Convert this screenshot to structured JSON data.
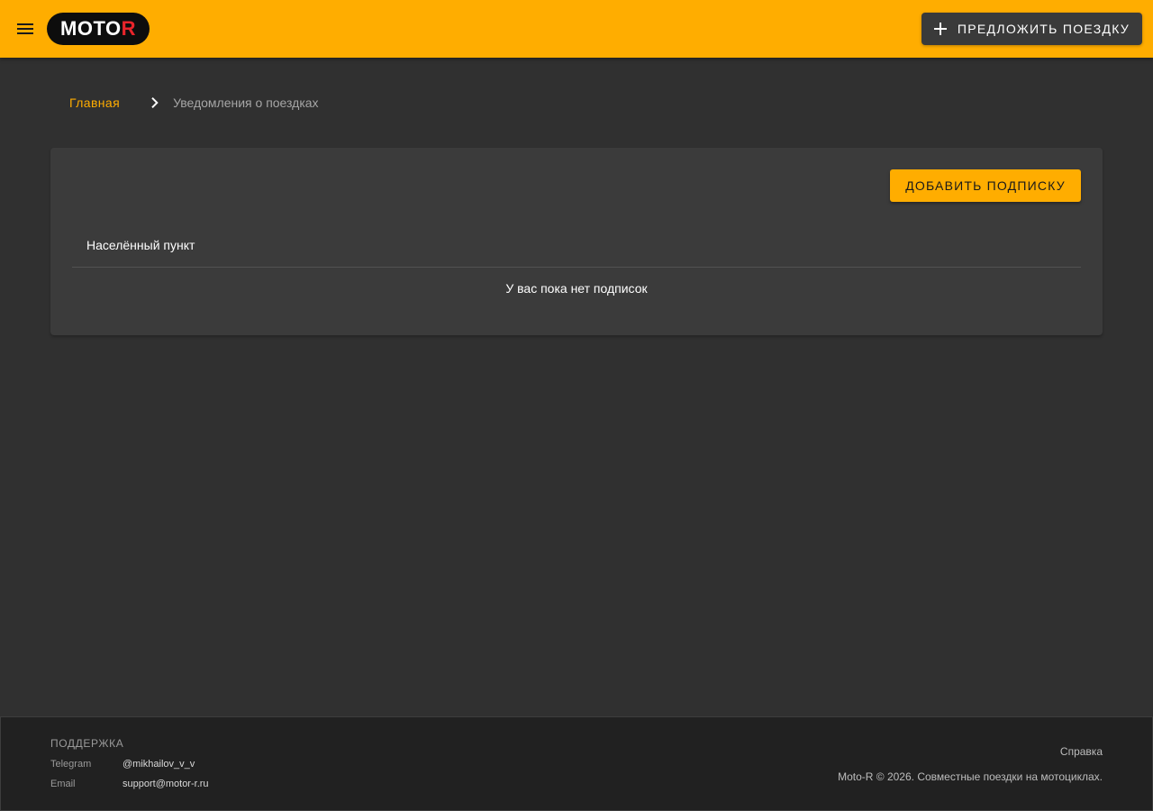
{
  "header": {
    "logo_text_main": "MOTO",
    "logo_text_accent": "R",
    "suggest_button_label": "ПРЕДЛОЖИТЬ ПОЕЗДКУ",
    "icons": {
      "menu": "menu-icon",
      "plus": "plus-icon"
    }
  },
  "breadcrumb": {
    "home": "Главная",
    "current": "Уведомления о поездках",
    "separator_icon": "chevron-right-icon"
  },
  "subscriptions": {
    "add_button_label": "ДОБАВИТЬ ПОДПИСКУ",
    "column_header": "Населённый пункт",
    "empty_message": "У вас пока нет подписок"
  },
  "footer": {
    "support_title": "ПОДДЕРЖКА",
    "contacts": [
      {
        "label": "Telegram",
        "value": "@mikhailov_v_v"
      },
      {
        "label": "Email",
        "value": "support@motor-r.ru"
      }
    ],
    "help_link": "Справка",
    "copyright": "Moto-R © 2026. Совместные поездки на мотоциклах."
  },
  "colors": {
    "accent": "#FFAD00",
    "background": "#303030",
    "card": "#3b3b3b",
    "footer": "#212121",
    "logo_accent": "#e8242b"
  }
}
